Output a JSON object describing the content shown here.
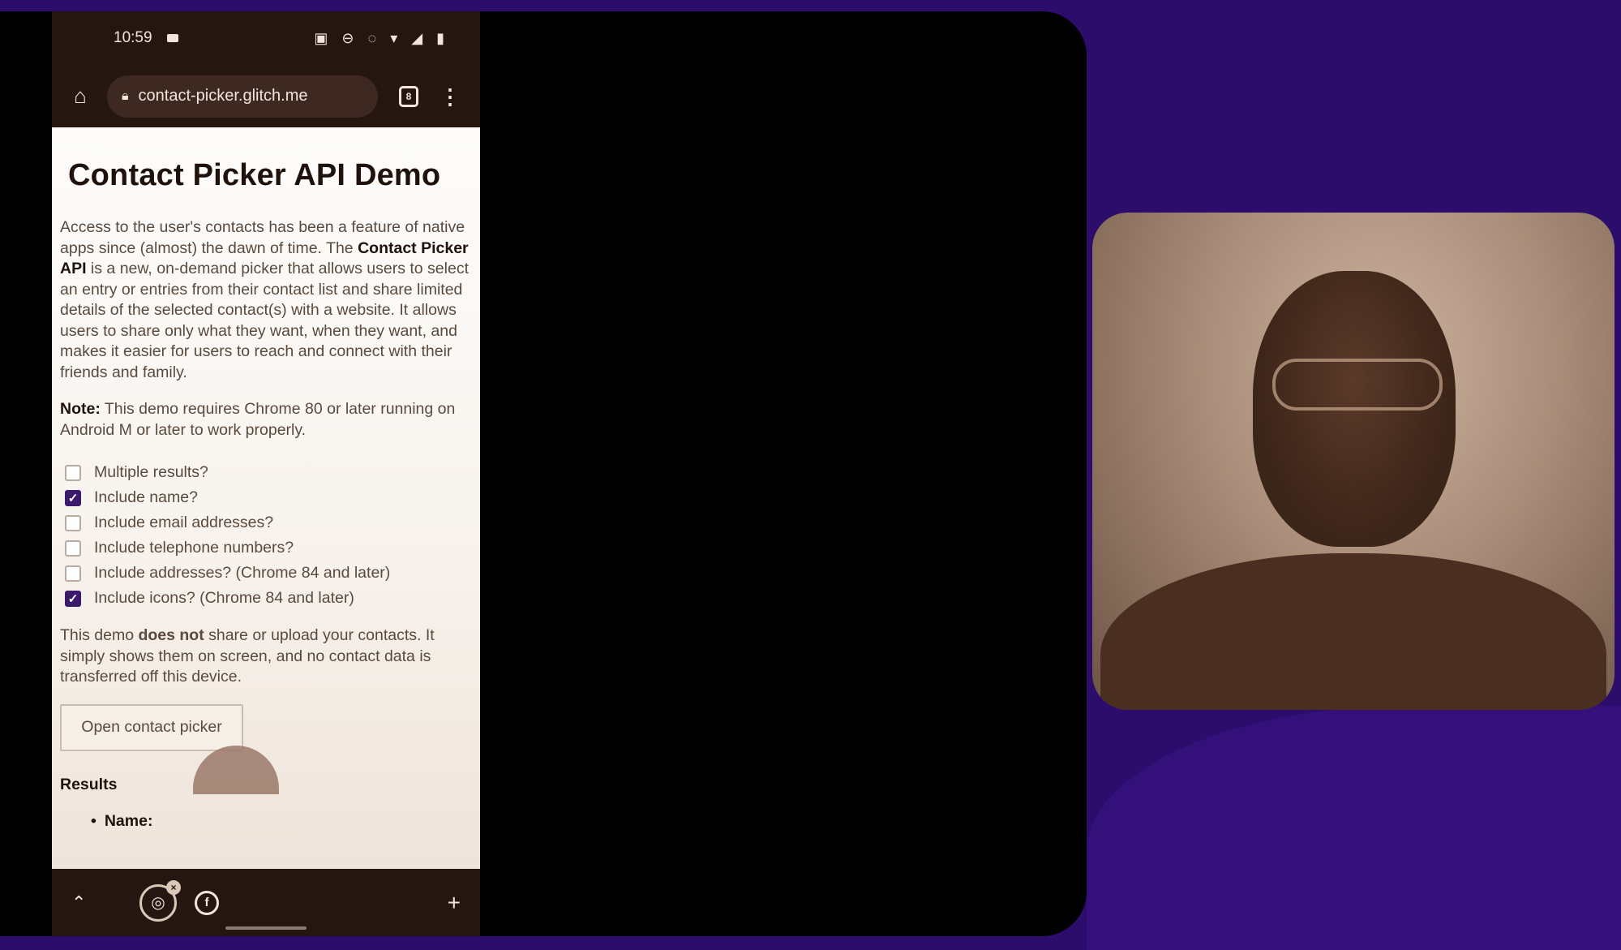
{
  "statusbar": {
    "time": "10:59",
    "icons": "▣ ⊖ ◌ ▾ ◢ ▮"
  },
  "browser": {
    "url": "contact-picker.glitch.me",
    "tab_count": "8",
    "home_icon": "home-icon",
    "lock_icon": "lock-icon",
    "menu_icon": "more-vert-icon"
  },
  "page": {
    "title": "Contact Picker API Demo",
    "intro_part1": "Access to the user's contacts has been a feature of native apps since (almost) the dawn of time. The ",
    "intro_bold": "Contact Picker API",
    "intro_part2": " is a new, on-demand picker that allows users to select an entry or entries from their contact list and share limited details of the selected contact(s) with a website. It allows users to share only what they want, when they want, and makes it easier for users to reach and connect with their friends and family.",
    "note_label": "Note:",
    "note_text": " This demo requires Chrome 80 or later running on Android M or later to work properly.",
    "options": [
      {
        "label": "Multiple results?",
        "checked": false
      },
      {
        "label": "Include name?",
        "checked": true
      },
      {
        "label": "Include email addresses?",
        "checked": false
      },
      {
        "label": "Include telephone numbers?",
        "checked": false
      },
      {
        "label": "Include addresses? (Chrome 84 and later)",
        "checked": false
      },
      {
        "label": "Include icons? (Chrome 84 and later)",
        "checked": true
      }
    ],
    "disclaimer_part1": "This demo ",
    "disclaimer_bold": "does not",
    "disclaimer_part2": " share or upload your contacts. It simply shows them on screen, and no contact data is transferred off this device.",
    "open_button": "Open contact picker",
    "results_title": "Results",
    "results_name_label": "Name:"
  },
  "bottombar": {
    "up_icon": "chevron-up-icon",
    "glitch_icon": "glitch-icon",
    "facebook_icon": "facebook-icon",
    "plus_icon": "plus-icon"
  },
  "colors": {
    "frame_background": "#2c0d6b",
    "checkbox_accent": "#3b1a6b",
    "browser_chrome": "#261612"
  }
}
